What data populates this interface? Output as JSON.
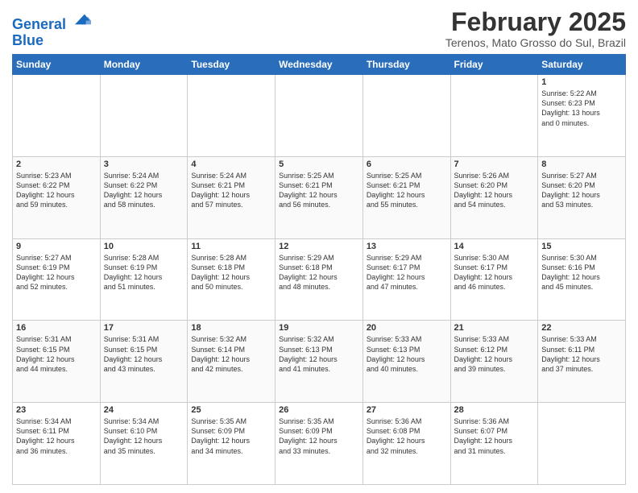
{
  "header": {
    "logo_line1": "General",
    "logo_line2": "Blue",
    "month": "February 2025",
    "location": "Terenos, Mato Grosso do Sul, Brazil"
  },
  "days_of_week": [
    "Sunday",
    "Monday",
    "Tuesday",
    "Wednesday",
    "Thursday",
    "Friday",
    "Saturday"
  ],
  "weeks": [
    [
      {
        "day": "",
        "info": ""
      },
      {
        "day": "",
        "info": ""
      },
      {
        "day": "",
        "info": ""
      },
      {
        "day": "",
        "info": ""
      },
      {
        "day": "",
        "info": ""
      },
      {
        "day": "",
        "info": ""
      },
      {
        "day": "1",
        "info": "Sunrise: 5:22 AM\nSunset: 6:23 PM\nDaylight: 13 hours\nand 0 minutes."
      }
    ],
    [
      {
        "day": "2",
        "info": "Sunrise: 5:23 AM\nSunset: 6:22 PM\nDaylight: 12 hours\nand 59 minutes."
      },
      {
        "day": "3",
        "info": "Sunrise: 5:24 AM\nSunset: 6:22 PM\nDaylight: 12 hours\nand 58 minutes."
      },
      {
        "day": "4",
        "info": "Sunrise: 5:24 AM\nSunset: 6:21 PM\nDaylight: 12 hours\nand 57 minutes."
      },
      {
        "day": "5",
        "info": "Sunrise: 5:25 AM\nSunset: 6:21 PM\nDaylight: 12 hours\nand 56 minutes."
      },
      {
        "day": "6",
        "info": "Sunrise: 5:25 AM\nSunset: 6:21 PM\nDaylight: 12 hours\nand 55 minutes."
      },
      {
        "day": "7",
        "info": "Sunrise: 5:26 AM\nSunset: 6:20 PM\nDaylight: 12 hours\nand 54 minutes."
      },
      {
        "day": "8",
        "info": "Sunrise: 5:27 AM\nSunset: 6:20 PM\nDaylight: 12 hours\nand 53 minutes."
      }
    ],
    [
      {
        "day": "9",
        "info": "Sunrise: 5:27 AM\nSunset: 6:19 PM\nDaylight: 12 hours\nand 52 minutes."
      },
      {
        "day": "10",
        "info": "Sunrise: 5:28 AM\nSunset: 6:19 PM\nDaylight: 12 hours\nand 51 minutes."
      },
      {
        "day": "11",
        "info": "Sunrise: 5:28 AM\nSunset: 6:18 PM\nDaylight: 12 hours\nand 50 minutes."
      },
      {
        "day": "12",
        "info": "Sunrise: 5:29 AM\nSunset: 6:18 PM\nDaylight: 12 hours\nand 48 minutes."
      },
      {
        "day": "13",
        "info": "Sunrise: 5:29 AM\nSunset: 6:17 PM\nDaylight: 12 hours\nand 47 minutes."
      },
      {
        "day": "14",
        "info": "Sunrise: 5:30 AM\nSunset: 6:17 PM\nDaylight: 12 hours\nand 46 minutes."
      },
      {
        "day": "15",
        "info": "Sunrise: 5:30 AM\nSunset: 6:16 PM\nDaylight: 12 hours\nand 45 minutes."
      }
    ],
    [
      {
        "day": "16",
        "info": "Sunrise: 5:31 AM\nSunset: 6:15 PM\nDaylight: 12 hours\nand 44 minutes."
      },
      {
        "day": "17",
        "info": "Sunrise: 5:31 AM\nSunset: 6:15 PM\nDaylight: 12 hours\nand 43 minutes."
      },
      {
        "day": "18",
        "info": "Sunrise: 5:32 AM\nSunset: 6:14 PM\nDaylight: 12 hours\nand 42 minutes."
      },
      {
        "day": "19",
        "info": "Sunrise: 5:32 AM\nSunset: 6:13 PM\nDaylight: 12 hours\nand 41 minutes."
      },
      {
        "day": "20",
        "info": "Sunrise: 5:33 AM\nSunset: 6:13 PM\nDaylight: 12 hours\nand 40 minutes."
      },
      {
        "day": "21",
        "info": "Sunrise: 5:33 AM\nSunset: 6:12 PM\nDaylight: 12 hours\nand 39 minutes."
      },
      {
        "day": "22",
        "info": "Sunrise: 5:33 AM\nSunset: 6:11 PM\nDaylight: 12 hours\nand 37 minutes."
      }
    ],
    [
      {
        "day": "23",
        "info": "Sunrise: 5:34 AM\nSunset: 6:11 PM\nDaylight: 12 hours\nand 36 minutes."
      },
      {
        "day": "24",
        "info": "Sunrise: 5:34 AM\nSunset: 6:10 PM\nDaylight: 12 hours\nand 35 minutes."
      },
      {
        "day": "25",
        "info": "Sunrise: 5:35 AM\nSunset: 6:09 PM\nDaylight: 12 hours\nand 34 minutes."
      },
      {
        "day": "26",
        "info": "Sunrise: 5:35 AM\nSunset: 6:09 PM\nDaylight: 12 hours\nand 33 minutes."
      },
      {
        "day": "27",
        "info": "Sunrise: 5:36 AM\nSunset: 6:08 PM\nDaylight: 12 hours\nand 32 minutes."
      },
      {
        "day": "28",
        "info": "Sunrise: 5:36 AM\nSunset: 6:07 PM\nDaylight: 12 hours\nand 31 minutes."
      },
      {
        "day": "",
        "info": ""
      }
    ]
  ]
}
